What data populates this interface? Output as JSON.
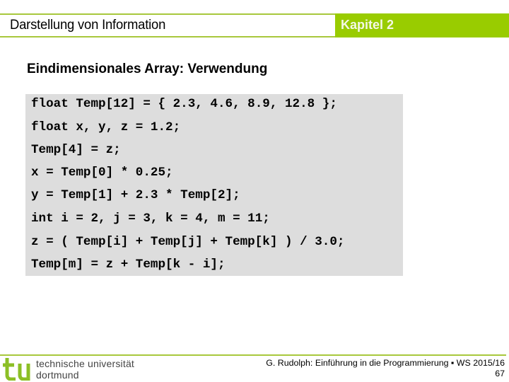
{
  "header": {
    "title": "Darstellung von Information",
    "chapter": "Kapitel 2"
  },
  "slide": {
    "title": "Eindimensionales Array: Verwendung",
    "code_lines": [
      "float Temp[12] = { 2.3, 4.6, 8.9, 12.8 };",
      "float x, y, z = 1.2;",
      "Temp[4] = z;",
      "x = Temp[0] * 0.25;",
      "y = Temp[1] + 2.3 * Temp[2];",
      "int i = 2, j = 3, k = 4, m = 11;",
      "z = ( Temp[i] + Temp[j] + Temp[k] ) / 3.0;",
      "Temp[m] = z + Temp[k - i];"
    ]
  },
  "footer": {
    "logo_icon": "tu-logo-icon",
    "university_line1": "technische universität",
    "university_line2": "dortmund",
    "credit": "G. Rudolph: Einführung in die Programmierung ▪ WS 2015/16",
    "page_number": "67"
  },
  "colors": {
    "accent_green": "#99cc00",
    "line_green": "#a8c83c",
    "code_background": "#dddddd"
  }
}
